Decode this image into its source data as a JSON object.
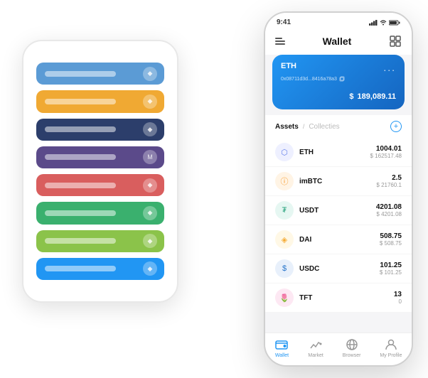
{
  "back_phone": {
    "cards": [
      {
        "color": "#5b9bd5",
        "label": "card-1",
        "icon": "◆"
      },
      {
        "color": "#f0a933",
        "label": "card-2",
        "icon": "◆"
      },
      {
        "color": "#2c3e6b",
        "label": "card-3",
        "icon": "◆"
      },
      {
        "color": "#5b4a8a",
        "label": "card-4",
        "icon": "M"
      },
      {
        "color": "#d95e5e",
        "label": "card-5",
        "icon": "◆"
      },
      {
        "color": "#3ab06e",
        "label": "card-6",
        "icon": "◆"
      },
      {
        "color": "#8bc34a",
        "label": "card-7",
        "icon": "◆"
      },
      {
        "color": "#2196f3",
        "label": "card-8",
        "icon": "◆"
      }
    ]
  },
  "front_phone": {
    "status_bar": {
      "time": "9:41",
      "signal": "▌▌▌",
      "wifi": "WiFi",
      "battery": "🔋"
    },
    "header": {
      "title": "Wallet",
      "menu_icon": "menu-icon",
      "expand_icon": "expand-icon"
    },
    "eth_card": {
      "label": "ETH",
      "address": "0x08711d3d...8416a78a3",
      "copy_icon": "copy-icon",
      "more_icon": "...",
      "dollar_sign": "$",
      "balance": "189,089.11"
    },
    "assets": {
      "tab_active": "Assets",
      "tab_separator": "/",
      "tab_inactive": "Collecties",
      "add_label": "+",
      "items": [
        {
          "name": "ETH",
          "icon_color": "#627eea",
          "icon_text": "⬡",
          "icon_bg": "#eef0ff",
          "amount": "1004.01",
          "usd": "$ 162517.48"
        },
        {
          "name": "imBTC",
          "icon_color": "#f7931a",
          "icon_text": "ⓘ",
          "icon_bg": "#fff4e5",
          "amount": "2.5",
          "usd": "$ 21760.1"
        },
        {
          "name": "USDT",
          "icon_color": "#26a17b",
          "icon_text": "₮",
          "icon_bg": "#e6f7f2",
          "amount": "4201.08",
          "usd": "$ 4201.08"
        },
        {
          "name": "DAI",
          "icon_color": "#f5ac37",
          "icon_text": "◈",
          "icon_bg": "#fff8e6",
          "amount": "508.75",
          "usd": "$ 508.75"
        },
        {
          "name": "USDC",
          "icon_color": "#2775ca",
          "icon_text": "$",
          "icon_bg": "#e8f0fb",
          "amount": "101.25",
          "usd": "$ 101.25"
        },
        {
          "name": "TFT",
          "icon_color": "#e84393",
          "icon_text": "🌷",
          "icon_bg": "#fde8f3",
          "amount": "13",
          "usd": "0"
        }
      ]
    },
    "nav": {
      "items": [
        {
          "label": "Wallet",
          "active": true,
          "icon": "wallet-icon"
        },
        {
          "label": "Market",
          "active": false,
          "icon": "market-icon"
        },
        {
          "label": "Browser",
          "active": false,
          "icon": "browser-icon"
        },
        {
          "label": "My Profile",
          "active": false,
          "icon": "profile-icon"
        }
      ]
    }
  }
}
